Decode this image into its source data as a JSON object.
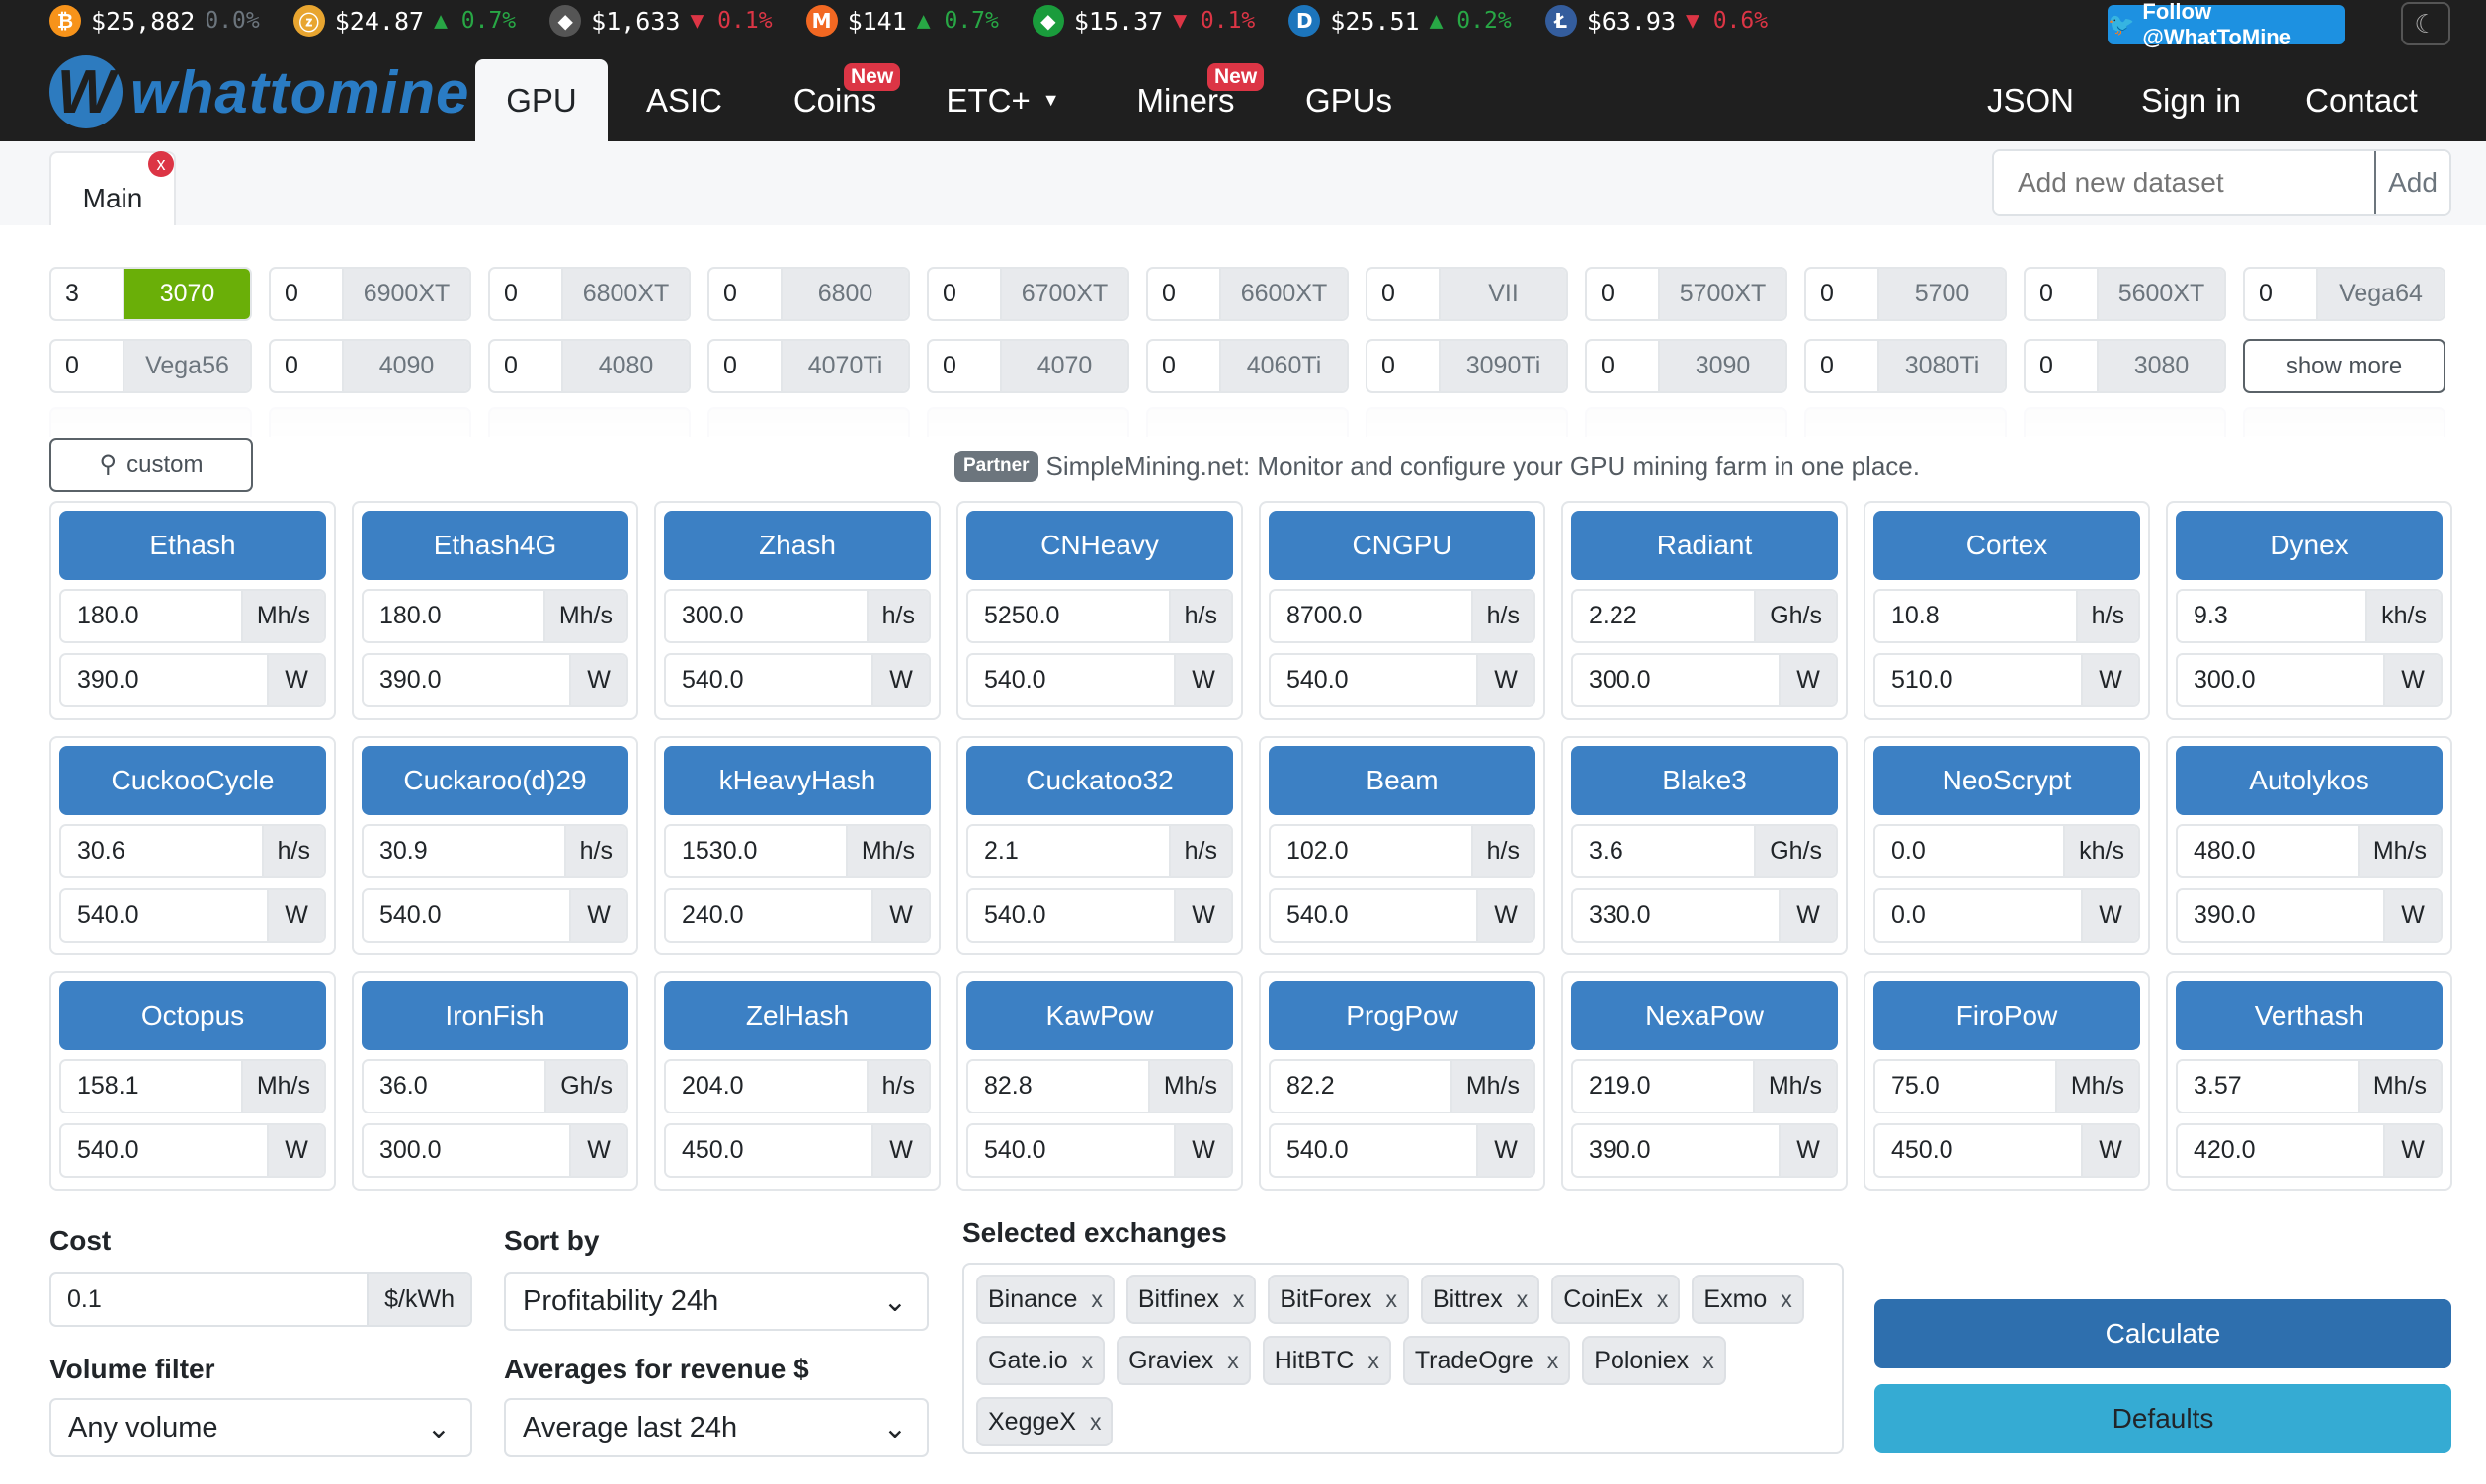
{
  "ticker": [
    {
      "icon": "bitcoin-icon",
      "glyph": "₿",
      "color": "#f7931a",
      "price": "$25,882",
      "change": "0.0%",
      "dir": "flat"
    },
    {
      "icon": "zcash-icon",
      "glyph": "ⓩ",
      "color": "#e8a530",
      "price": "$24.87",
      "change": "▲ 0.7%",
      "dir": "up"
    },
    {
      "icon": "ethereum-classic-icon",
      "glyph": "◆",
      "color": "#555",
      "price": "$1,633",
      "change": "▼ 0.1%",
      "dir": "down"
    },
    {
      "icon": "monero-icon",
      "glyph": "M",
      "color": "#f26822",
      "price": "$141",
      "change": "▲ 0.7%",
      "dir": "up"
    },
    {
      "icon": "ethereum-green-icon",
      "glyph": "◆",
      "color": "#1a9c3c",
      "price": "$15.37",
      "change": "▼ 0.1%",
      "dir": "down"
    },
    {
      "icon": "dash-icon",
      "glyph": "D",
      "color": "#1c75bc",
      "price": "$25.51",
      "change": "▲ 0.2%",
      "dir": "up"
    },
    {
      "icon": "litecoin-icon",
      "glyph": "Ł",
      "color": "#345d9d",
      "price": "$63.93",
      "change": "▼ 0.6%",
      "dir": "down"
    }
  ],
  "follow_label": "Follow @WhatToMine",
  "logo_text": "whattomine",
  "nav": {
    "gpu": "GPU",
    "asic": "ASIC",
    "coins": "Coins",
    "etc": "ETC+",
    "miners": "Miners",
    "gpus": "GPUs",
    "new_badge": "New",
    "json": "JSON",
    "signin": "Sign in",
    "contact": "Contact"
  },
  "tabs": {
    "main": "Main",
    "close": "x"
  },
  "dataset": {
    "placeholder": "Add new dataset",
    "add": "Add"
  },
  "gpus": [
    {
      "qty": "3",
      "name": "3070",
      "selected": true
    },
    {
      "qty": "0",
      "name": "6900XT"
    },
    {
      "qty": "0",
      "name": "6800XT"
    },
    {
      "qty": "0",
      "name": "6800"
    },
    {
      "qty": "0",
      "name": "6700XT"
    },
    {
      "qty": "0",
      "name": "6600XT"
    },
    {
      "qty": "0",
      "name": "VII"
    },
    {
      "qty": "0",
      "name": "5700XT"
    },
    {
      "qty": "0",
      "name": "5700"
    },
    {
      "qty": "0",
      "name": "5600XT"
    },
    {
      "qty": "0",
      "name": "Vega64"
    },
    {
      "qty": "0",
      "name": "Vega56"
    },
    {
      "qty": "0",
      "name": "4090"
    },
    {
      "qty": "0",
      "name": "4080"
    },
    {
      "qty": "0",
      "name": "4070Ti"
    },
    {
      "qty": "0",
      "name": "4070"
    },
    {
      "qty": "0",
      "name": "4060Ti"
    },
    {
      "qty": "0",
      "name": "3090Ti"
    },
    {
      "qty": "0",
      "name": "3090"
    },
    {
      "qty": "0",
      "name": "3080Ti"
    },
    {
      "qty": "0",
      "name": "3080"
    }
  ],
  "show_more": "show more",
  "custom_label": "custom",
  "partner": {
    "badge": "Partner",
    "text": "SimpleMining.net: Monitor and configure your GPU mining farm in one place."
  },
  "algorithms": [
    {
      "name": "Ethash",
      "hashrate": "180.0",
      "unit": "Mh/s",
      "power": "390.0"
    },
    {
      "name": "Ethash4G",
      "hashrate": "180.0",
      "unit": "Mh/s",
      "power": "390.0"
    },
    {
      "name": "Zhash",
      "hashrate": "300.0",
      "unit": "h/s",
      "power": "540.0"
    },
    {
      "name": "CNHeavy",
      "hashrate": "5250.0",
      "unit": "h/s",
      "power": "540.0"
    },
    {
      "name": "CNGPU",
      "hashrate": "8700.0",
      "unit": "h/s",
      "power": "540.0"
    },
    {
      "name": "Radiant",
      "hashrate": "2.22",
      "unit": "Gh/s",
      "power": "300.0"
    },
    {
      "name": "Cortex",
      "hashrate": "10.8",
      "unit": "h/s",
      "power": "510.0"
    },
    {
      "name": "Dynex",
      "hashrate": "9.3",
      "unit": "kh/s",
      "power": "300.0"
    },
    {
      "name": "CuckooCycle",
      "hashrate": "30.6",
      "unit": "h/s",
      "power": "540.0"
    },
    {
      "name": "Cuckaroo(d)29",
      "hashrate": "30.9",
      "unit": "h/s",
      "power": "540.0"
    },
    {
      "name": "kHeavyHash",
      "hashrate": "1530.0",
      "unit": "Mh/s",
      "power": "240.0"
    },
    {
      "name": "Cuckatoo32",
      "hashrate": "2.1",
      "unit": "h/s",
      "power": "540.0"
    },
    {
      "name": "Beam",
      "hashrate": "102.0",
      "unit": "h/s",
      "power": "540.0"
    },
    {
      "name": "Blake3",
      "hashrate": "3.6",
      "unit": "Gh/s",
      "power": "330.0"
    },
    {
      "name": "NeoScrypt",
      "hashrate": "0.0",
      "unit": "kh/s",
      "power": "0.0"
    },
    {
      "name": "Autolykos",
      "hashrate": "480.0",
      "unit": "Mh/s",
      "power": "390.0"
    },
    {
      "name": "Octopus",
      "hashrate": "158.1",
      "unit": "Mh/s",
      "power": "540.0"
    },
    {
      "name": "IronFish",
      "hashrate": "36.0",
      "unit": "Gh/s",
      "power": "300.0"
    },
    {
      "name": "ZelHash",
      "hashrate": "204.0",
      "unit": "h/s",
      "power": "450.0"
    },
    {
      "name": "KawPow",
      "hashrate": "82.8",
      "unit": "Mh/s",
      "power": "540.0"
    },
    {
      "name": "ProgPow",
      "hashrate": "82.2",
      "unit": "Mh/s",
      "power": "540.0"
    },
    {
      "name": "NexaPow",
      "hashrate": "219.0",
      "unit": "Mh/s",
      "power": "390.0"
    },
    {
      "name": "FiroPow",
      "hashrate": "75.0",
      "unit": "Mh/s",
      "power": "450.0"
    },
    {
      "name": "Verthash",
      "hashrate": "3.57",
      "unit": "Mh/s",
      "power": "420.0"
    }
  ],
  "power_unit": "W",
  "settings": {
    "cost_label": "Cost",
    "cost_value": "0.1",
    "cost_unit": "$/kWh",
    "sort_label": "Sort by",
    "sort_value": "Profitability 24h",
    "volume_label": "Volume filter",
    "volume_value": "Any volume",
    "avg_label": "Averages for revenue $",
    "avg_value": "Average last 24h"
  },
  "exchanges_label": "Selected exchanges",
  "exchanges": [
    "Binance",
    "Bitfinex",
    "BitForex",
    "Bittrex",
    "CoinEx",
    "Exmo",
    "Gate.io",
    "Graviex",
    "HitBTC",
    "TradeOgre",
    "Poloniex",
    "XeggeX"
  ],
  "chip_remove": "x",
  "buttons": {
    "calculate": "Calculate",
    "defaults": "Defaults"
  }
}
